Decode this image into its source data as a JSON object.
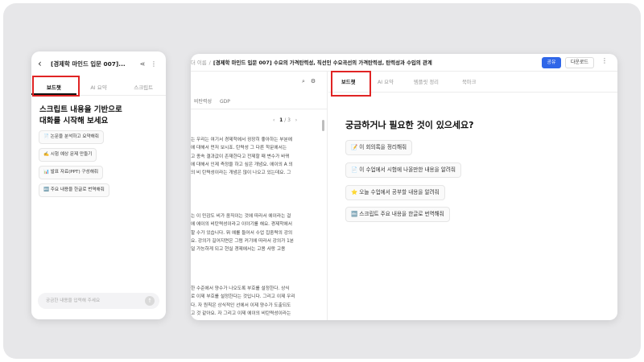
{
  "mobile": {
    "title": "[경제학 마인드 입문 007]...",
    "tabs": [
      "보드챗",
      "AI 요약",
      "스크립트"
    ],
    "heading_line1": "스크립트 내용을 기반으로",
    "heading_line2": "대화를 시작해 보세요",
    "suggestions": [
      "📄 논문을 분석하고 요약해줘",
      "✍️ 시험 예상 문제 만들기",
      "📊 발표 자료(PPT) 구성해줘",
      "🔤 주요 내용을 한글로 번역해줘"
    ],
    "input_placeholder": "궁금한 내용을 입력해 주세요"
  },
  "desktop": {
    "breadcrumb_prefix": "더 이름",
    "title": "[경제학 마인드 입문 007] 수요의 가격탄력성, 직선인 수요곡선의 가격탄력성, 탄력성과 수입의 관계",
    "share_label": "공유",
    "download_label": "다운로드",
    "left_tags": [
      "비탄력성",
      "GDP"
    ],
    "pager_current": "1",
    "pager_total": "/ 3",
    "script_para1": [
      "는 우리는 여기서 경제학에서 굉장히 좋아하는 부분에",
      "에 대해서 먼저 보시죠. 탄력성 그 다른 학문에서는",
      "고 종속 결과값이 존재한다고 전제할 때 변수가 바뀌",
      "에 대해서 인제 측정을 하고 싶은 개념요. 에이의 A 의",
      "의 비 탄력성이라는 개념은 많이 나오고 있는데요. 그"
    ],
    "script_para2": [
      "는 이 민감도 비가 움직이는 것에 따라서 에이라는 걸",
      "에 에이의 비탄력성이라고 이야기를 해요. 경제학에서",
      "할 수가 있습니다. 뭐 예를 들어서 수업 집중력의 강의",
      "요. 강의가 길어지면은 그럼 커기에 따라서 강의가 1분",
      "덜 가능하게 되고 현실 경제에서는 고용 사랑 고용"
    ],
    "script_para3": [
      "한 수준에서 양수가 나오도록 부호를 설정한다. 상식",
      "로 이제 부호를 설정한다는 것입니다. 그리고 이제 우리",
      "다. 자 원칙은 상식적인 선에서 이제 양수가 도출되도",
      "고 것 같아요. 자 그리고 이제 에이의 비탄력성이라는"
    ],
    "tabs": [
      "보드챗",
      "AI 요약",
      "템플릿 정리",
      "북마크"
    ],
    "heading": "궁금하거나 필요한 것이 있으세요?",
    "suggestions": [
      "📝 이 회의록을 정리해줘",
      "📄 이 수업에서 시험에 나올만한 내용을 알려줘",
      "⭐ 오늘 수업에서 공부할 내용을 알려줘",
      "🔤 스크립트 주요 내용을 한글로 번역해줘"
    ]
  }
}
